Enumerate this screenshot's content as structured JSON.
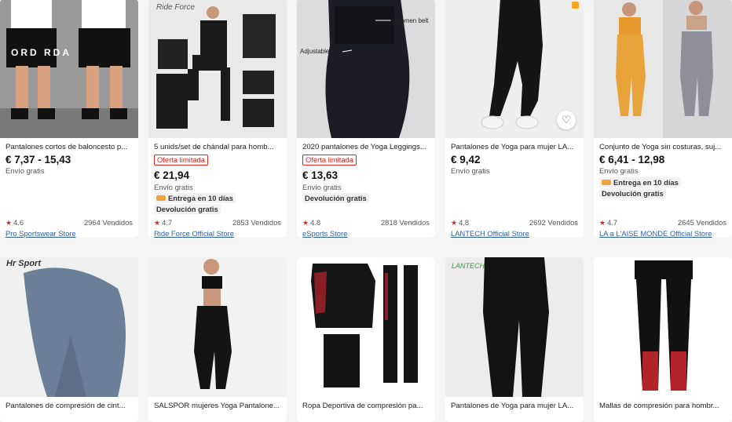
{
  "products_row1": [
    {
      "title": "Pantalones cortos de baloncesto p...",
      "price": "€ 7,37 - 15,43",
      "shipping": "Envío gratis",
      "rating": "4.6",
      "sold": "2964 Vendidos",
      "store": "Pro Sportswear Store",
      "image_text": "ORD RDA"
    },
    {
      "title": "5 unids/set de chándal para homb...",
      "badge": "Oferta limitada",
      "price": "€ 21,94",
      "shipping": "Envío gratis",
      "delivery": "Entrega en 10 días",
      "returns": "Devolución gratis",
      "rating": "4.7",
      "sold": "2853 Vendidos",
      "store": "Ride Force Official Store",
      "image_text": "Ride Force"
    },
    {
      "title": "2020 pantalones de Yoga Leggings...",
      "badge": "Oferta limitada",
      "price": "€ 13,63",
      "shipping": "Envío gratis",
      "returns": "Devolución gratis",
      "rating": "4.8",
      "sold": "2818 Vendidos",
      "store": "eSports Store",
      "image_text_1": "Abdomen belt",
      "image_text_2": "Adjustable"
    },
    {
      "title": "Pantalones de Yoga para mujer LA...",
      "price": "€ 9,42",
      "shipping": "Envío gratis",
      "rating": "4.8",
      "sold": "2692 Vendidos",
      "store": "LANTECH Official Store"
    },
    {
      "title": "Conjunto de Yoga sin costuras, suj...",
      "price": "€ 6,41 - 12,98",
      "shipping": "Envío gratis",
      "delivery": "Entrega en 10 días",
      "returns": "Devolución gratis",
      "rating": "4.7",
      "sold": "2645 Vendidos",
      "store": "LA a L'AISE MONDE Official Store"
    }
  ],
  "products_row2": [
    {
      "title": "Pantalones de compresión de cint...",
      "image_text": "Hr Sport"
    },
    {
      "title": "SALSPOR mujeres Yoga Pantalone..."
    },
    {
      "title": "Ropa Deportiva de compresión pa..."
    },
    {
      "title": "Pantalones de Yoga para mujer LA...",
      "image_text": "LANTECH"
    },
    {
      "title": "Mallas de compresión para hombr..."
    }
  ],
  "colors": {
    "accent": "#e1251b",
    "store_link": "#2f5fa8",
    "background": "#f5f5f5"
  },
  "icons": {
    "wishlist": "heart-outline-icon",
    "rating": "star-icon",
    "delivery": "truck-icon"
  }
}
